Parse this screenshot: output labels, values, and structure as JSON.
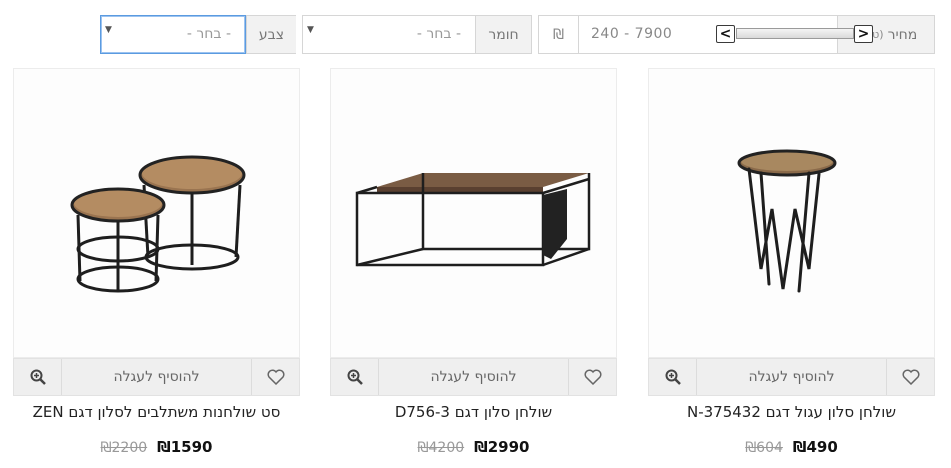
{
  "filters": {
    "price": {
      "label": "מחיר",
      "hint": "(טווח)",
      "currency": "₪",
      "range_text": "240 - 7900",
      "left_arrow": "<",
      "right_arrow": ">"
    },
    "material": {
      "label": "חומר",
      "value": "- בחר -"
    },
    "color": {
      "label": "צבע",
      "value": "- בחר -"
    }
  },
  "products": [
    {
      "title": "שולחן סלון עגול דגם N-375432",
      "price": "₪490",
      "old_price": "₪604",
      "add_to_cart": "להוסיף לעגלה"
    },
    {
      "title": "שולחן סלון דגם D756-3",
      "price": "₪2990",
      "old_price": "₪4200",
      "add_to_cart": "להוסיף לעגלה"
    },
    {
      "title": "סט שולחנות משתלבים לסלון דגם ZEN",
      "price": "₪1590",
      "old_price": "₪2200",
      "add_to_cart": "להוסיף לעגלה"
    }
  ],
  "icons": {
    "wishlist": "heart-icon",
    "zoom": "zoom-in-icon",
    "dropdown": "caret-down-icon"
  }
}
